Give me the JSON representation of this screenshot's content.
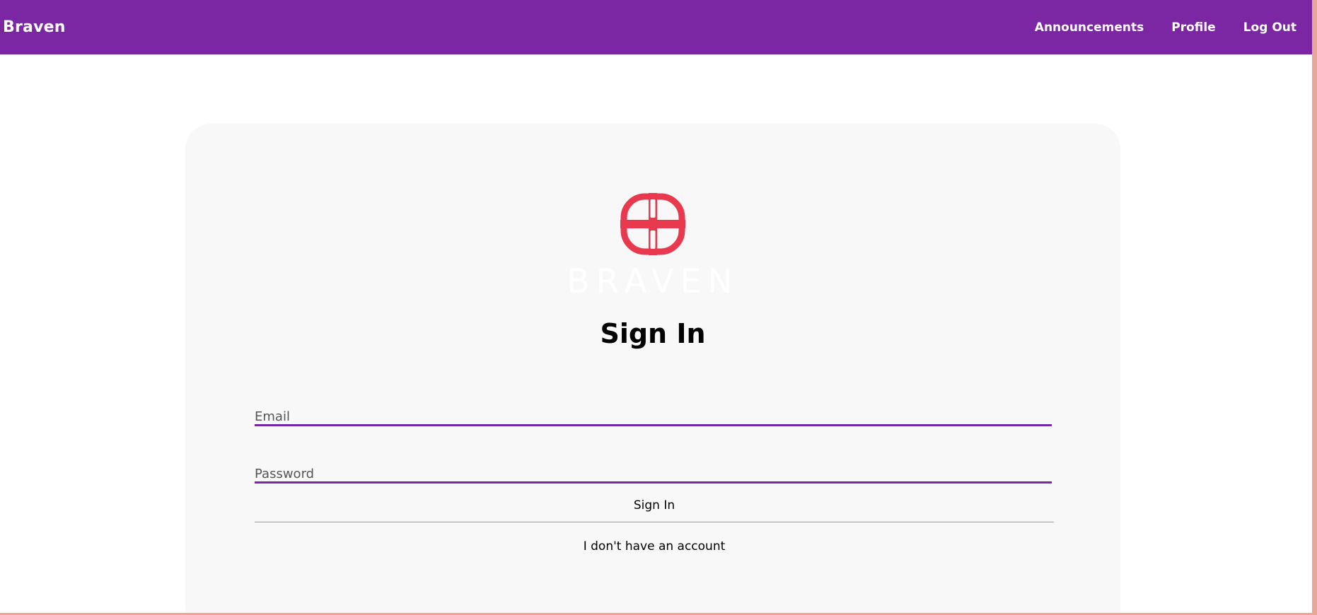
{
  "navbar": {
    "brand": "Braven",
    "links": [
      {
        "label": "Announcements"
      },
      {
        "label": "Profile"
      },
      {
        "label": "Log Out"
      }
    ]
  },
  "logo": {
    "wordmark": "BRAVEN",
    "mark_color": "#e8394e",
    "icon": "braven-logo-icon"
  },
  "page_title": "Sign In",
  "form": {
    "email_label": "Email",
    "email_value": "",
    "password_label": "Password",
    "password_value": "",
    "submit_label": "Sign In",
    "no_account_label": "I don't have an account"
  },
  "colors": {
    "navbar": "#7b27a3",
    "accent": "#7b27a3",
    "card": "#f8f8f8",
    "logo_mark": "#e8394e"
  }
}
